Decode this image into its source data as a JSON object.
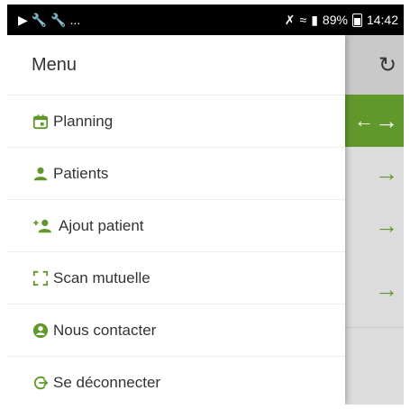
{
  "status_bar": {
    "left_icons": [
      "notification-icon",
      "wrench-icon",
      "wrench-icon"
    ],
    "ellipsis": "...",
    "battery": "89%",
    "time": "14:42"
  },
  "drawer": {
    "title": "Menu",
    "items": [
      {
        "label": "Planning",
        "icon": "calendar-icon"
      },
      {
        "label": "Patients",
        "icon": "user-icon"
      },
      {
        "label": "Ajout patient",
        "icon": "user-add-icon"
      },
      {
        "label": "Scan mutuelle",
        "icon": "scan-icon"
      },
      {
        "label": "Nous contacter",
        "icon": "account-circle-icon"
      },
      {
        "label": "Se déconnecter",
        "icon": "logout-icon"
      }
    ]
  },
  "colors": {
    "accent": "#61982b",
    "drawer_bg": "#ffffff",
    "overlay_bg": "#dcdcdc",
    "status_bar_bg": "#000000"
  }
}
